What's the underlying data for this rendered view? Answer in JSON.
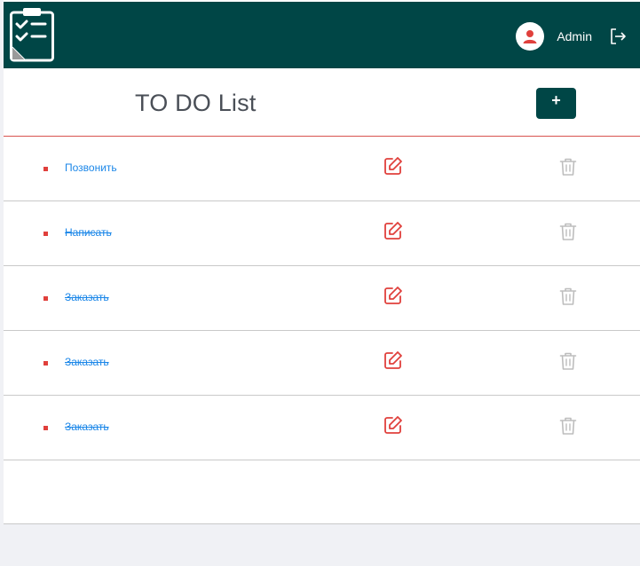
{
  "header": {
    "user_name": "Admin",
    "brand_color": "#004646",
    "logo_icon": "clipboard-checklist-icon",
    "avatar_icon": "user-avatar-icon",
    "logout_icon": "logout-icon"
  },
  "main": {
    "title": "TO DO List",
    "add_button_label": "+"
  },
  "tasks": [
    {
      "text": "Позвонить",
      "done": false
    },
    {
      "text": "Написать",
      "done": true
    },
    {
      "text": "Заказать",
      "done": true
    },
    {
      "text": "Заказать",
      "done": true
    },
    {
      "text": "Заказать",
      "done": true
    }
  ],
  "colors": {
    "accent_red": "#e0403c",
    "link_blue": "#1a86e8",
    "muted_gray": "#bdbdbd"
  }
}
